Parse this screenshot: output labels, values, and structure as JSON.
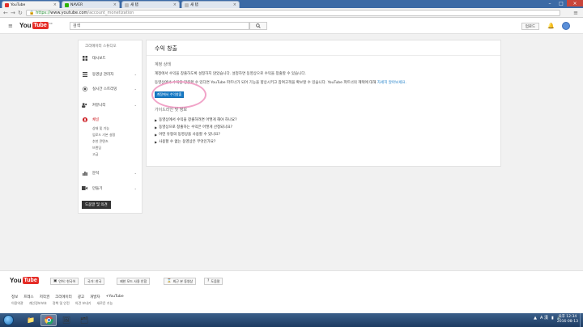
{
  "browser": {
    "tabs": [
      {
        "label": "YouTube",
        "color": "#e52d27",
        "active": true
      },
      {
        "label": "NAVER",
        "color": "#2db400",
        "active": false
      },
      {
        "label": "새 탭",
        "color": "#bdbdbd",
        "active": false
      },
      {
        "label": "새 탭",
        "color": "#bdbdbd",
        "active": false
      }
    ],
    "url_scheme": "https://",
    "url_host": "www.youtube.com",
    "url_path": "/account_monetization"
  },
  "header": {
    "logo_you": "You",
    "logo_tube": "Tube",
    "logo_region": "KR",
    "search_placeholder": "검색",
    "upload_label": "업로드"
  },
  "sidebar": {
    "title": "크리에이터 스튜디오",
    "items": [
      {
        "label": "대시보드",
        "icon": "dashboard-icon"
      },
      {
        "label": "동영상 관리자",
        "icon": "video-manager-icon"
      },
      {
        "label": "실시간 스트리밍",
        "icon": "live-streaming-icon"
      },
      {
        "label": "커뮤니티",
        "icon": "community-icon"
      },
      {
        "label": "채널",
        "icon": "channel-icon"
      }
    ],
    "channel_subitems": [
      "상태 및 기능",
      "업로드 기본 설정",
      "추천 콘텐츠",
      "브랜딩",
      "고급"
    ],
    "analytics_label": "분석",
    "create_label": "만들기",
    "feedback_label": "도움말 및 의견"
  },
  "main": {
    "title": "수익 창출",
    "account_status_head": "계정 상태",
    "status_line": "계정에서 수익을 창출하도록 설정하지 않았습니다. 설정하면 동영상으로 수익을 창출할 수 있습니다.",
    "partner_line": "동영상에서 수익을 창출할 수 있다면 YouTube 파트너가 되어 기능을 향상시키고 참여고객을 확보할 수 있습니다. YouTube 파트너의 혜택에 대해",
    "partner_link": "자세히 알아보세요.",
    "enable_button": "계정에서 수익창출",
    "guidelines_head": "가이드라인 및 정보",
    "faq": [
      "동영상에서 수익을 창출하려면 어떻게 해야 하나요?",
      "동영상으로 창출하는 수익은 어떻게 산정되나요?",
      "어떤 유형의 동영상을 사용할 수 있나요?",
      "사용할 수 없는 동영상은 무엇인가요?"
    ]
  },
  "footer": {
    "buttons": [
      {
        "label": "언어: 한국어",
        "icon": "language-icon"
      },
      {
        "label": "국가: 한국",
        "icon": "none"
      },
      {
        "label": "제한 모드 사용 안함",
        "icon": "none"
      },
      {
        "label": "최근 본 동영상",
        "icon": "history-icon"
      },
      {
        "label": "도움말",
        "icon": "help-icon"
      }
    ],
    "links_row1": [
      "정보",
      "프레스",
      "저작권",
      "크리에이터",
      "광고",
      "개발자",
      "+YouTube"
    ],
    "links_row2": [
      "이용약관",
      "개인정보보호",
      "정책 및 안전",
      "의견 보내기",
      "새로운 기능"
    ]
  },
  "taskbar": {
    "tray_lang": "A 漢",
    "clock_time": "오후 12:34",
    "clock_date": "2016-08-13"
  },
  "colors": {
    "youtube_red": "#e52d27",
    "link_blue": "#167ac6",
    "annotation_pink": "#f1a3c8"
  }
}
